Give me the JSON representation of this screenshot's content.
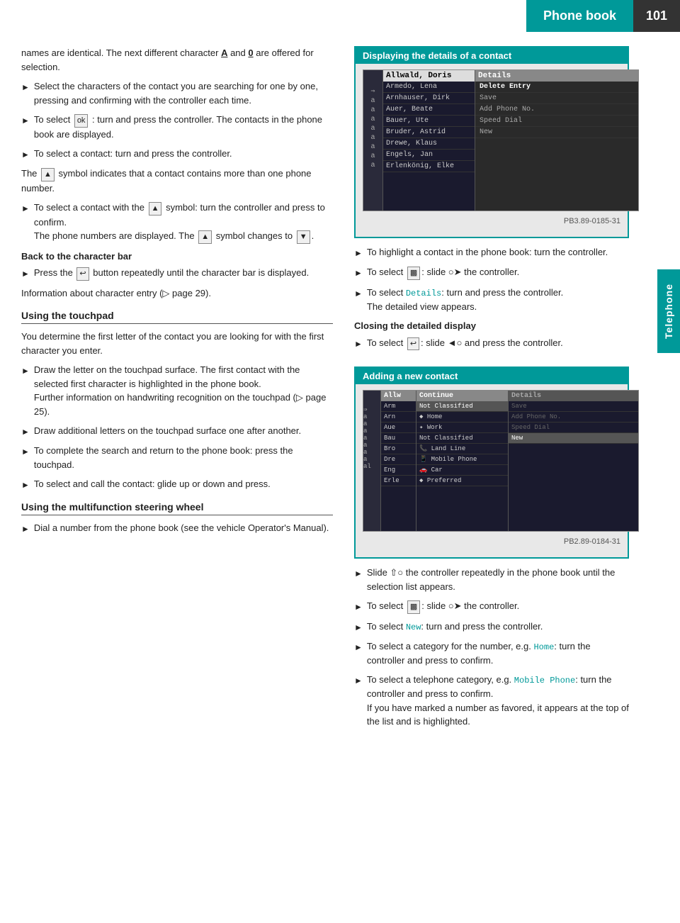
{
  "header": {
    "title": "Phone book",
    "page_number": "101"
  },
  "side_tab": "Telephone",
  "left_col": {
    "intro_text": "names are identical. The next different character A and 0 are offered for selection.",
    "bullets_1": [
      "Select the characters of the contact you are searching for one by one, pressing and confirming with the controller each time.",
      "To select ok : turn and press the controller. The contacts in the phone book are displayed.",
      "To select a contact: turn and press the controller."
    ],
    "note": "The ▲ symbol indicates that a contact contains more than one phone number.",
    "bullets_2": [
      "To select a contact with the ▲ symbol: turn the controller and press to confirm. The phone numbers are displayed. The ▲ symbol changes to ▼."
    ],
    "back_heading": "Back to the character bar",
    "bullets_3": [
      "Press the ↩ button repeatedly until the character bar is displayed."
    ],
    "info_text": "Information about character entry (▷ page 29).",
    "using_touchpad_heading": "Using the touchpad",
    "touchpad_intro": "You determine the first letter of the contact you are looking for with the first character you enter.",
    "bullets_touchpad": [
      "Draw the letter on the touchpad surface. The first contact with the selected first character is highlighted in the phone book. Further information on handwriting recognition on the touchpad (▷ page 25).",
      "Draw additional letters on the touchpad surface one after another.",
      "To complete the search and return to the phone book: press the touchpad.",
      "To select and call the contact: glide up or down and press."
    ],
    "using_msw_heading": "Using the multifunction steering wheel",
    "bullets_msw": [
      "Dial a number from the phone book (see the vehicle Operator's Manual)."
    ]
  },
  "right_col": {
    "display_section": {
      "title": "Displaying the details of a contact",
      "image_caption": "PB3.89-0185-31",
      "bullets": [
        "To highlight a contact in the phone book: turn the controller.",
        "To select ⬛: slide ◎➜ the controller.",
        "To select Details: turn and press the controller. The detailed view appears."
      ],
      "closing_heading": "Closing the detailed display",
      "bullets_close": [
        "To select ↩: slide ◀◎ and press the controller."
      ]
    },
    "adding_section": {
      "title": "Adding a new contact",
      "image_caption": "PB2.89-0184-31",
      "bullets": [
        "Slide ↑◎ the controller repeatedly in the phone book until the selection list appears.",
        "To select ⬛: slide ◎➜ the controller.",
        "To select New: turn and press the controller.",
        "To select a category for the number, e.g. Home: turn the controller and press to confirm.",
        "To select a telephone category, e.g. Mobile Phone: turn the controller and press to confirm. If you have marked a number as favored, it appears at the top of the list and is highlighted."
      ]
    }
  },
  "phonebook_display": {
    "contacts": [
      "Allwald, Doris",
      "Armedo, Lena",
      "Arnhauser, Dirk",
      "Auer, Beate",
      "Bauer, Ute",
      "Bruder, Astrid",
      "Drewe, Klaus",
      "Engels, Jan",
      "Erlenkönig, Elke"
    ],
    "menu_items": [
      "Delete Entry",
      "Save",
      "Add Phone No.",
      "Speed Dial",
      "New"
    ]
  },
  "add_contact_display": {
    "col3_header": "Continue",
    "col3_items": [
      "Not Classified",
      "♦ Home",
      "✦ Work",
      "Not Classified",
      "📞 Land Line",
      "📱 Mobile Phone",
      "🚗 Car",
      "◆ Preferred"
    ],
    "col4_items": [
      "Details",
      "Save",
      "Add Phone No.",
      "Speed Dial",
      "New"
    ]
  }
}
